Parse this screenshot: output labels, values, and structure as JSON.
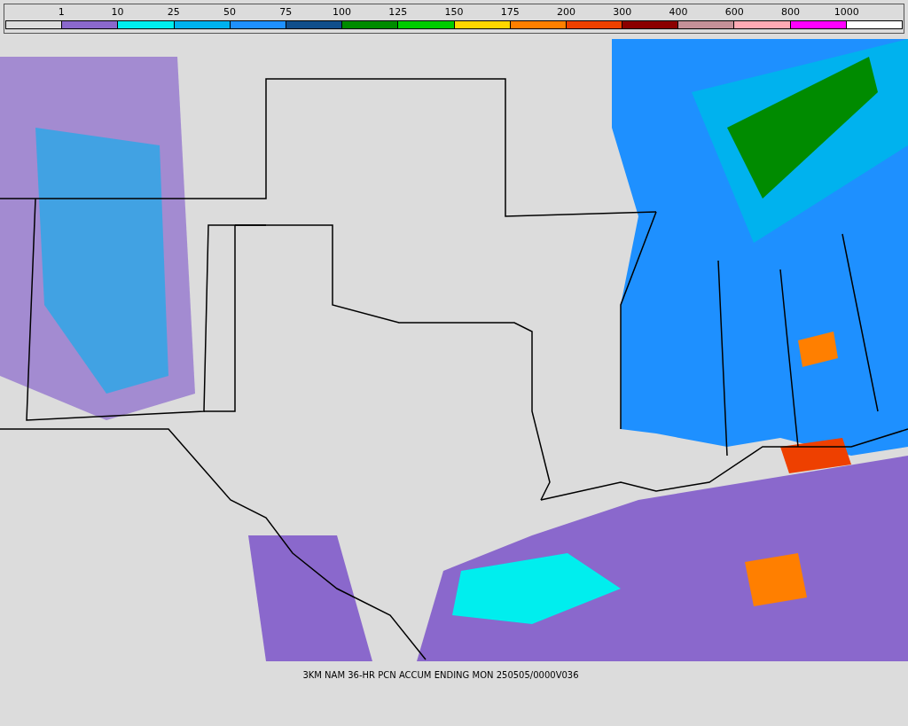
{
  "legend": {
    "segments": [
      {
        "color": "#dcdcdc",
        "label": "1"
      },
      {
        "color": "#8a68cc",
        "label": "10"
      },
      {
        "color": "#00eeee",
        "label": "25"
      },
      {
        "color": "#00b2ee",
        "label": "50"
      },
      {
        "color": "#1e90ff",
        "label": "75"
      },
      {
        "color": "#104e8b",
        "label": "100"
      },
      {
        "color": "#008b00",
        "label": "125"
      },
      {
        "color": "#00cd00",
        "label": "150"
      },
      {
        "color": "#ffd700",
        "label": "175"
      },
      {
        "color": "#ff7f00",
        "label": "200"
      },
      {
        "color": "#ee4000",
        "label": "300"
      },
      {
        "color": "#8b0000",
        "label": "400"
      },
      {
        "color": "#c59198",
        "label": "600"
      },
      {
        "color": "#ffaab4",
        "label": "800"
      },
      {
        "color": "#ff00ff",
        "label": "1000"
      },
      {
        "color": "#ffffff"
      }
    ]
  },
  "caption": "3KM NAM 36-HR PCN ACCUM ENDING MON 250505/0000V036"
}
